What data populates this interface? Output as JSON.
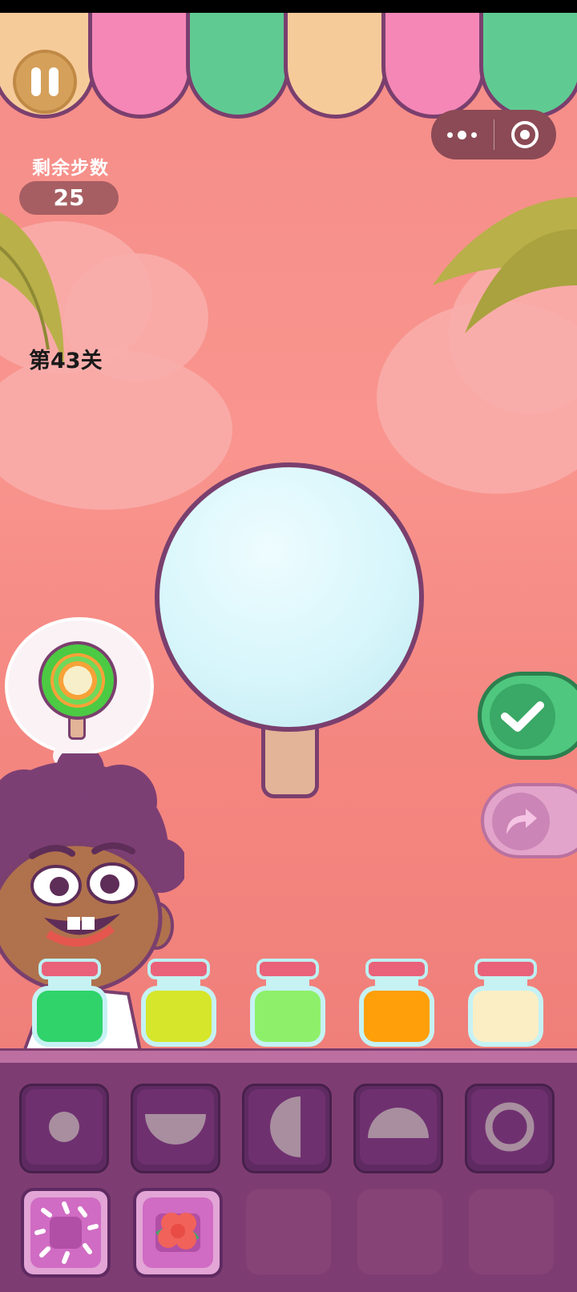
{
  "hud": {
    "steps_label": "剩余步数",
    "steps_value": "25",
    "level_label": "第43关"
  },
  "target": {
    "item": "lollipop-icon",
    "colors": [
      "#4cca43",
      "#f7a238",
      "#f7efc9"
    ]
  },
  "popsicle": {
    "base_color": "#d7f6fb",
    "stick_color": "#e3b498"
  },
  "jars": [
    {
      "name": "green",
      "color": "#2fd36a"
    },
    {
      "name": "yellow-green",
      "color": "#d6e62a"
    },
    {
      "name": "lime",
      "color": "#8ef06a"
    },
    {
      "name": "orange",
      "color": "#ff9f0a"
    },
    {
      "name": "cream",
      "color": "#fbeec5"
    }
  ],
  "shapes": [
    {
      "name": "small-dot-icon"
    },
    {
      "name": "bottom-half-icon"
    },
    {
      "name": "left-half-icon"
    },
    {
      "name": "top-half-icon"
    },
    {
      "name": "ring-icon"
    }
  ],
  "toppings": [
    {
      "name": "sprinkles-icon"
    },
    {
      "name": "flower-icon"
    }
  ],
  "colors": {
    "accent_outline": "#7a3f6e",
    "confirm_green": "#4fc77f",
    "redo_pink": "#e2a4cb"
  }
}
